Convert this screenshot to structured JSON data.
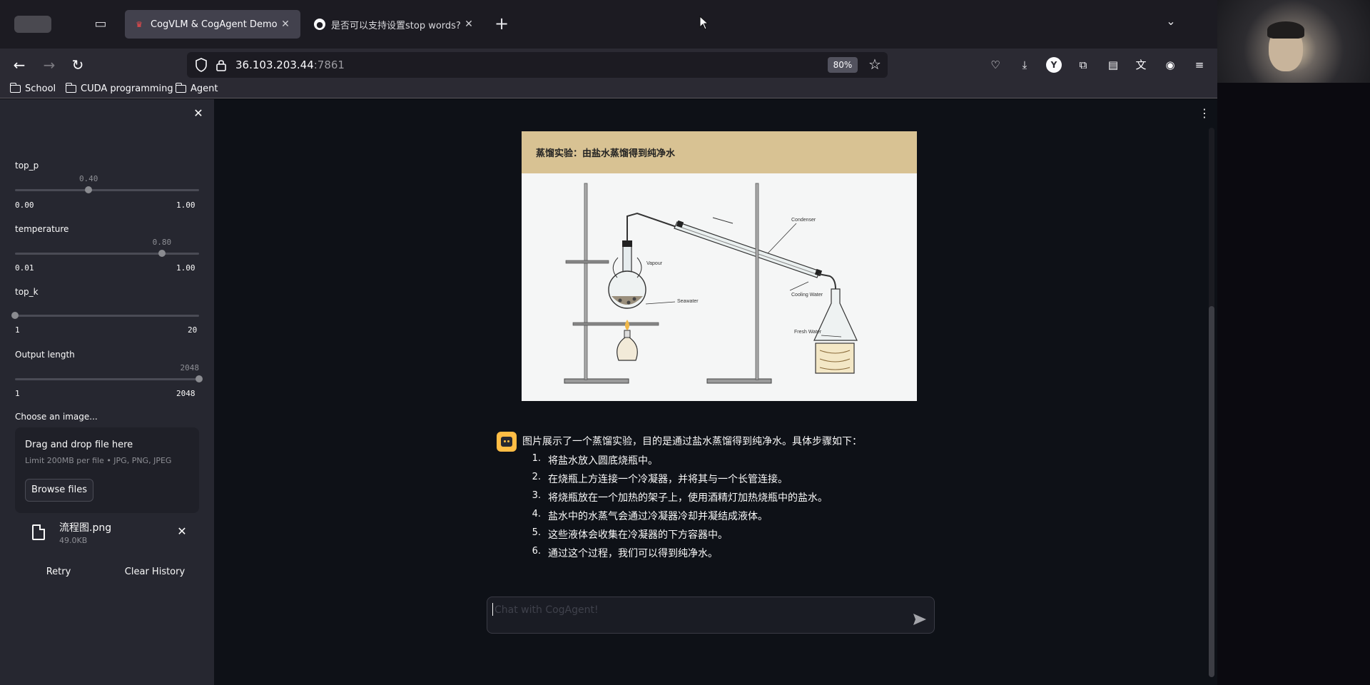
{
  "browser": {
    "tabs": [
      {
        "title": "CogVLM & CogAgent Demo",
        "active": true
      },
      {
        "title": "是否可以支持设置stop words?",
        "active": false
      }
    ],
    "url_host": "36.103.203.44",
    "url_port": ":7861",
    "zoom": "80%",
    "bookmarks": [
      "School",
      "CUDA programming",
      "Agent"
    ],
    "toolbar_icons": [
      "pocket-icon",
      "download-icon",
      "yandex-icon",
      "extensions-icon",
      "shortcut-icon",
      "translate-icon",
      "account-icon",
      "menu-icon"
    ]
  },
  "sidebar": {
    "sliders": [
      {
        "label": "top_p",
        "value": "0.40",
        "min": "0.00",
        "max": "1.00",
        "fraction": 0.4
      },
      {
        "label": "temperature",
        "value": "0.80",
        "min": "0.01",
        "max": "1.00",
        "fraction": 0.798
      },
      {
        "label": "top_k",
        "value": "1",
        "min": "1",
        "max": "20",
        "fraction": 0.0
      },
      {
        "label": "Output length",
        "value": "2048",
        "min": "1",
        "max": "2048",
        "fraction": 1.0
      }
    ],
    "uploader": {
      "label": "Choose an image...",
      "drop_text": "Drag and drop file here",
      "limit_text": "Limit 200MB per file • JPG, PNG, JPEG",
      "browse_label": "Browse files"
    },
    "file": {
      "name": "流程图.png",
      "size": "49.0KB"
    },
    "retry_label": "Retry",
    "clear_label": "Clear History"
  },
  "chat": {
    "image": {
      "title": "蒸馏实验：由盐水蒸馏得到纯净水",
      "labels": {
        "condenser": "Condenser",
        "vapour": "Vapour",
        "seawater": "Seawater",
        "cooling_water": "Cooling Water",
        "fresh_water": "Fresh Water"
      }
    },
    "assistant_message": {
      "intro": "图片展示了一个蒸馏实验，目的是通过盐水蒸馏得到纯净水。具体步骤如下：",
      "steps": [
        {
          "n": "1.",
          "text": "将盐水放入圆底烧瓶中。"
        },
        {
          "n": "2.",
          "text": "在烧瓶上方连接一个冷凝器，并将其与一个长管连接。"
        },
        {
          "n": "3.",
          "text": "将烧瓶放在一个加热的架子上，使用酒精灯加热烧瓶中的盐水。"
        },
        {
          "n": "4.",
          "text": "盐水中的水蒸气会通过冷凝器冷却并凝结成液体。"
        },
        {
          "n": "5.",
          "text": "这些液体会收集在冷凝器的下方容器中。"
        },
        {
          "n": "6.",
          "text": "通过这个过程，我们可以得到纯净水。"
        }
      ]
    },
    "input_placeholder": "Chat with CogAgent!"
  },
  "colors": {
    "sidebar_bg": "#262730",
    "main_bg": "#0e1117",
    "bot_avatar": "#ffbd45",
    "diagram_header": "#d8c293"
  }
}
